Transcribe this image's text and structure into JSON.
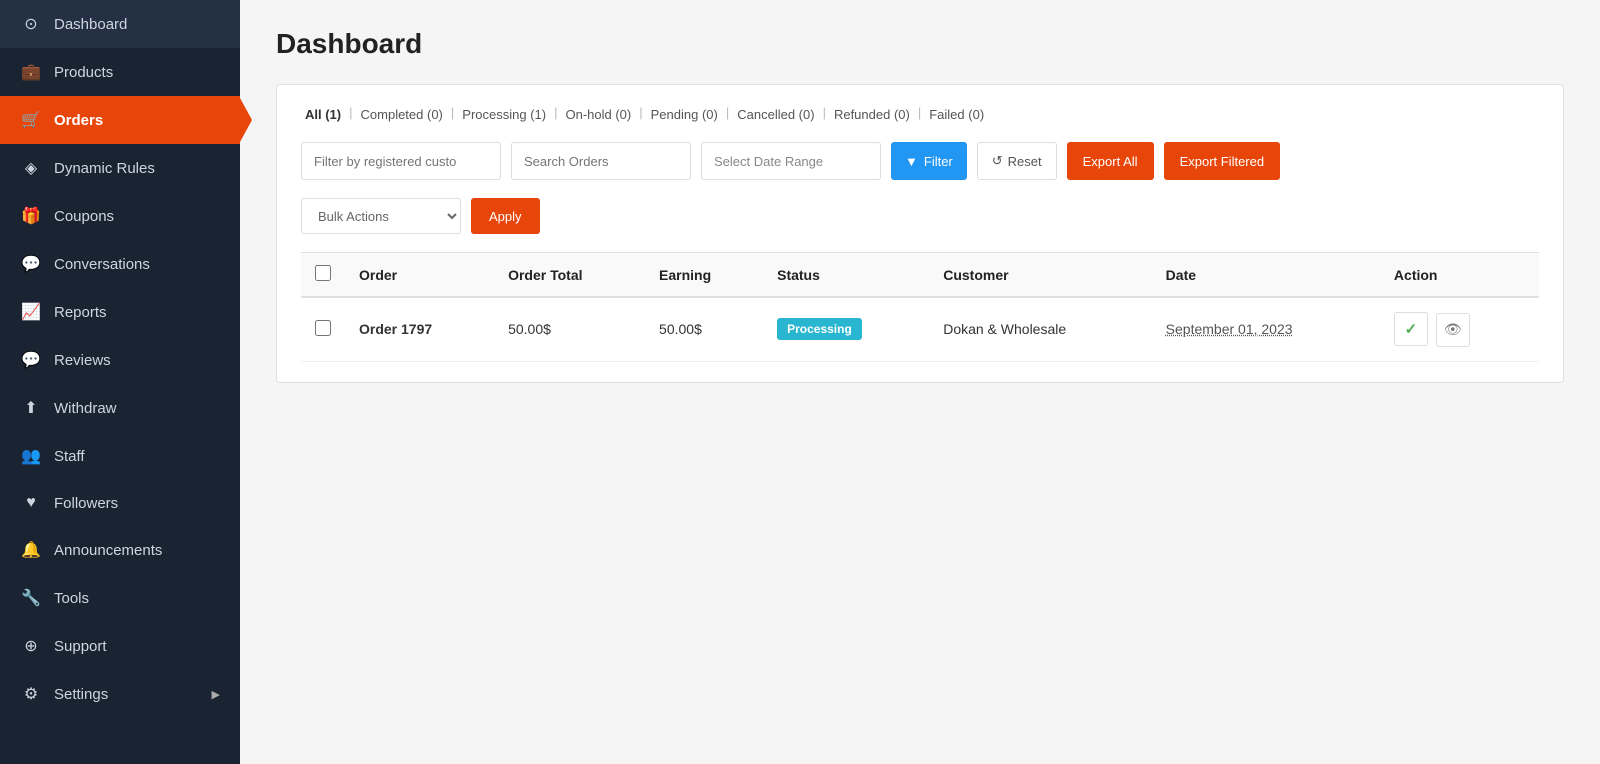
{
  "page": {
    "title": "Dashboard"
  },
  "sidebar": {
    "items": [
      {
        "id": "dashboard",
        "label": "Dashboard",
        "icon": "⊙",
        "active": false
      },
      {
        "id": "products",
        "label": "Products",
        "icon": "💼",
        "active": false
      },
      {
        "id": "orders",
        "label": "Orders",
        "icon": "🛒",
        "active": true
      },
      {
        "id": "dynamic-rules",
        "label": "Dynamic Rules",
        "icon": "◈",
        "active": false
      },
      {
        "id": "coupons",
        "label": "Coupons",
        "icon": "🎁",
        "active": false
      },
      {
        "id": "conversations",
        "label": "Conversations",
        "icon": "💬",
        "active": false
      },
      {
        "id": "reports",
        "label": "Reports",
        "icon": "📈",
        "active": false
      },
      {
        "id": "reviews",
        "label": "Reviews",
        "icon": "💬",
        "active": false
      },
      {
        "id": "withdraw",
        "label": "Withdraw",
        "icon": "⬆",
        "active": false
      },
      {
        "id": "staff",
        "label": "Staff",
        "icon": "👥",
        "active": false
      },
      {
        "id": "followers",
        "label": "Followers",
        "icon": "♥",
        "active": false
      },
      {
        "id": "announcements",
        "label": "Announcements",
        "icon": "🔔",
        "active": false
      },
      {
        "id": "tools",
        "label": "Tools",
        "icon": "🔧",
        "active": false
      },
      {
        "id": "support",
        "label": "Support",
        "icon": "⊕",
        "active": false
      },
      {
        "id": "settings",
        "label": "Settings",
        "icon": "⚙",
        "active": false
      }
    ]
  },
  "orders": {
    "tabs": [
      {
        "id": "all",
        "label": "All (1)",
        "active": true
      },
      {
        "id": "completed",
        "label": "Completed (0)",
        "active": false
      },
      {
        "id": "processing",
        "label": "Processing (1)",
        "active": false
      },
      {
        "id": "on-hold",
        "label": "On-hold (0)",
        "active": false
      },
      {
        "id": "pending",
        "label": "Pending (0)",
        "active": false
      },
      {
        "id": "cancelled",
        "label": "Cancelled (0)",
        "active": false
      },
      {
        "id": "refunded",
        "label": "Refunded (0)",
        "active": false
      },
      {
        "id": "failed",
        "label": "Failed (0)",
        "active": false
      }
    ],
    "filters": {
      "customer_placeholder": "Filter by registered custo",
      "search_placeholder": "Search Orders",
      "date_placeholder": "Select Date Range",
      "filter_btn": "Filter",
      "reset_btn": "Reset",
      "export_all_btn": "Export All",
      "export_filtered_btn": "Export Filtered"
    },
    "bulk": {
      "placeholder": "Bulk Actions",
      "apply_btn": "Apply"
    },
    "table": {
      "columns": [
        "",
        "Order",
        "Order Total",
        "Earning",
        "Status",
        "Customer",
        "Date",
        "Action"
      ],
      "rows": [
        {
          "id": "order-1797",
          "name": "Order 1797",
          "total": "50.00$",
          "earning": "50.00$",
          "status": "Processing",
          "status_color": "#29b6d0",
          "customer": "Dokan & Wholesale",
          "date": "September 01, 2023"
        }
      ]
    }
  }
}
